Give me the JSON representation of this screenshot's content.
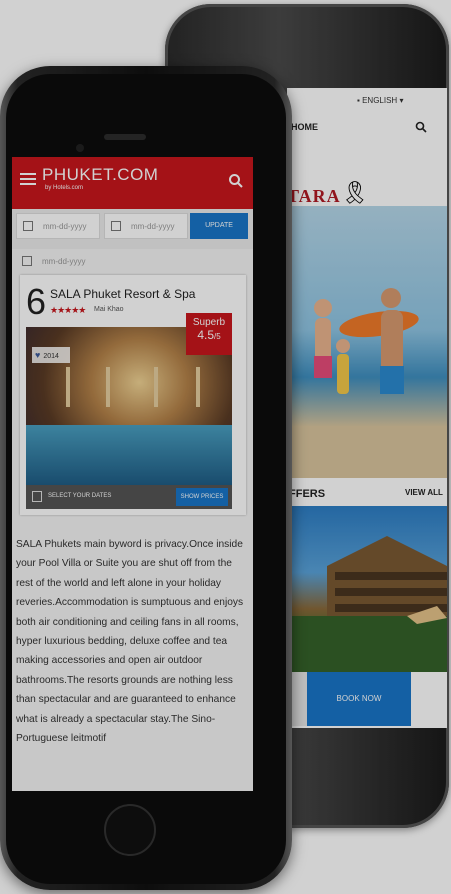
{
  "back_phone": {
    "nav_home": "HOME",
    "language": "ENGLISH",
    "brand_partial": "TARA",
    "section_title_partial": "FFERS",
    "view_all": "VIEW ALL",
    "book_now": "BOOK NOW"
  },
  "front_phone": {
    "header": {
      "title": "PHUKET.COM",
      "subtitle": "by Hotels.com"
    },
    "dates": {
      "checkin_placeholder": "mm-dd-yyyy",
      "checkout_placeholder": "mm-dd-yyyy",
      "update_label": "UPDATE",
      "row2_placeholder": "mm-dd-yyyy"
    },
    "hotel": {
      "rank": "6",
      "name": "SALA Phuket Resort & Spa",
      "stars": "★★★★★",
      "location": "Mai Khao",
      "rating_label": "Superb",
      "rating_value": "4.5",
      "rating_scale": "/5",
      "likes": "2014",
      "select_dates": "SELECT YOUR DATES",
      "show_prices": "SHOW PRICES",
      "description": "SALA Phukets main byword is privacy.Once inside your Pool Villa or Suite you are shut off from the rest of the world and left alone in your holiday reveries.Accommodation is sumptuous and enjoys both air conditioning and ceiling fans in all rooms, hyper luxurious bedding, deluxe coffee and tea making accessories and open air outdoor bathrooms.The resorts grounds are nothing less than spectacular and are guaranteed to enhance what is already a spectacular stay.The Sino-Portuguese leitmotif"
    }
  },
  "colors": {
    "brand_red": "#c8171d",
    "action_blue": "#1976c8"
  }
}
